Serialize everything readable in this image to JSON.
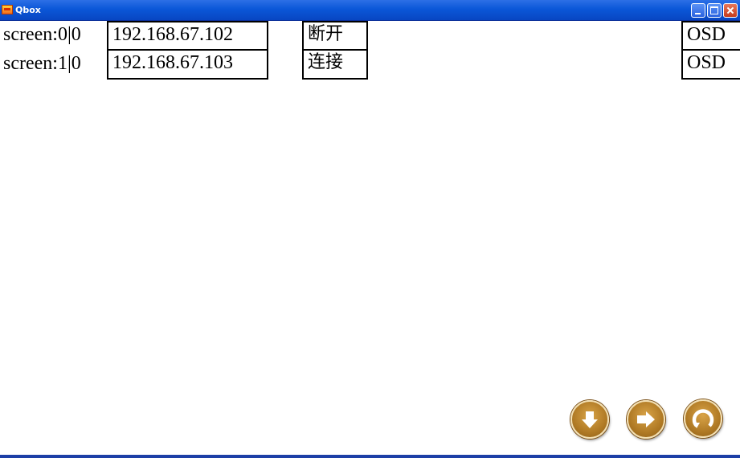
{
  "window": {
    "title": "Qbox",
    "controls": [
      "minimize-icon",
      "maximize-icon",
      "close-icon"
    ]
  },
  "rows": [
    {
      "screen": "screen:0|0",
      "ip": "192.168.67.102",
      "action": "断开",
      "osd": "OSD"
    },
    {
      "screen": "screen:1|0",
      "ip": "192.168.67.103",
      "action": "连接",
      "osd": "OSD"
    }
  ],
  "buttons": [
    {
      "icon": "arrow-down-icon"
    },
    {
      "icon": "arrow-right-icon"
    },
    {
      "icon": "refresh-icon"
    }
  ],
  "colors": {
    "titlebar": "#0b57d8",
    "button_gold": "#b07a25",
    "bottom_border": "#1c3fa6"
  }
}
